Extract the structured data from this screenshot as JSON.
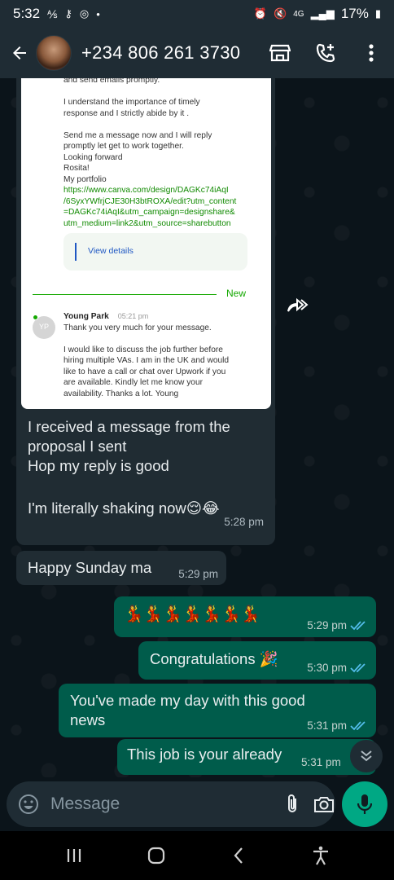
{
  "status_bar": {
    "time": "5:32",
    "network": "4G",
    "battery": "17%"
  },
  "header": {
    "contact_name": "+234 806 261 3730"
  },
  "quoted_screenshot": {
    "lines_top": [
      "and send emails promptly.",
      "",
      "I understand the importance of timely",
      "response and I strictly abide by it .",
      "",
      "Send me a message now and I will reply",
      "promptly let get to work together.",
      "Looking forward",
      "Rosita!",
      "My portfolio"
    ],
    "portfolio_link_lines": [
      "https://www.canva.com/design/DAGKc74iAqI",
      "/6SyxYWfrjCJE30H3btROXA/edit?utm_content",
      "=DAGKc74iAqI&utm_campaign=designshare&",
      "utm_medium=link2&utm_source=sharebutton"
    ],
    "view_details": "View details",
    "new_label": "New",
    "sender_initials": "YP",
    "sender_name": "Young Park",
    "sender_time": "05:21 pm",
    "reply_lines": [
      "Thank you very much for your message.",
      "",
      "I would like to discuss the job further before",
      "hiring multiple VAs. I am in the UK and would",
      "like to have a call or chat over Upwork if you",
      "are available. Kindly let me know your",
      "availability. Thanks a lot. Young"
    ]
  },
  "messages": [
    {
      "direction": "in",
      "lines": [
        "I received a message from the",
        "proposal  I sent",
        "Hop my reply is good",
        "",
        "I'm literally shaking now😌😂"
      ],
      "time": "5:28 pm"
    },
    {
      "direction": "in",
      "text": "Happy Sunday ma",
      "time": "5:29 pm"
    },
    {
      "direction": "out",
      "text": "💃💃💃💃💃💃💃",
      "time": "5:29 pm"
    },
    {
      "direction": "out",
      "text": "Congratulations 🎉",
      "time": "5:30 pm"
    },
    {
      "direction": "out",
      "lines": [
        "You've made my day with this good",
        "news"
      ],
      "time": "5:31 pm"
    },
    {
      "direction": "out",
      "text": "This job is your already",
      "time": "5:31 pm"
    }
  ],
  "input": {
    "placeholder": "Message"
  },
  "colors": {
    "accent": "#00a884",
    "outgoing_bubble": "#005c4b",
    "incoming_bubble": "#202c33",
    "read_ticks": "#53bdeb"
  }
}
